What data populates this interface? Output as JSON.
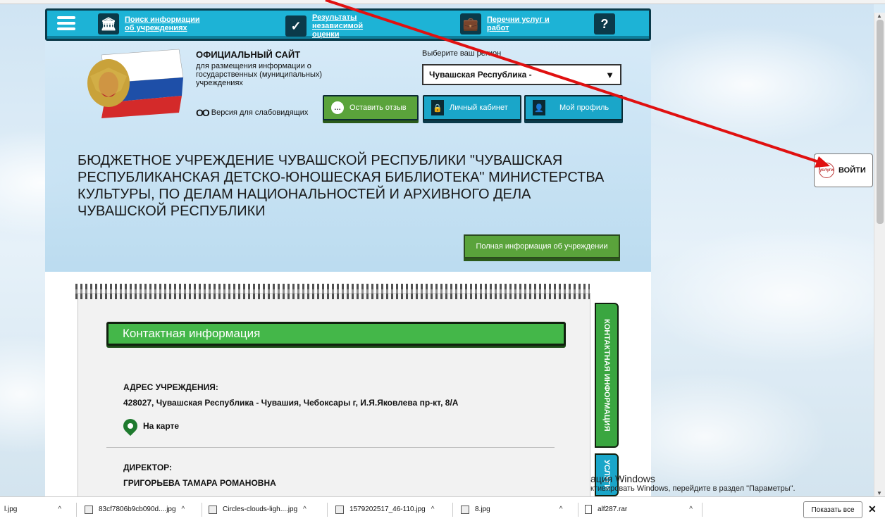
{
  "nav": {
    "item1": "Поиск информации об учреждениях",
    "item2": "Результаты независимой оценки",
    "item3": "Перечни услуг и работ"
  },
  "header": {
    "site_title": "ОФИЦИАЛЬНЫЙ САЙТ",
    "site_subtitle": "для размещения информации о государственных (муниципальных) учреждениях",
    "low_vision": "Версия для слабовидящих",
    "region_label": "Выберите ваш регион",
    "region_value": "Чувашская Республика -",
    "btn_feedback": "Оставить отзыв",
    "btn_cabinet": "Личный кабинет",
    "btn_profile": "Мой профиль"
  },
  "org": {
    "name": "БЮДЖЕТНОЕ УЧРЕЖДЕНИЕ ЧУВАШСКОЙ РЕСПУБЛИКИ \"ЧУВАШСКАЯ РЕСПУБЛИКАНСКАЯ ДЕТСКО-ЮНОШЕСКАЯ БИБЛИОТЕКА\" МИНИСТЕРСТВА КУЛЬТУРЫ, ПО ДЕЛАМ НАЦИОНАЛЬНОСТЕЙ И АРХИВНОГО ДЕЛА ЧУВАШСКОЙ РЕСПУБЛИКИ",
    "full_info_btn": "Полная информация об учреждении"
  },
  "contact": {
    "heading": "Контактная информация",
    "address_label": "АДРЕС УЧРЕЖДЕНИЯ:",
    "address_value": "428027, Чувашская Республика - Чувашия, Чебоксары г, И.Я.Яковлева пр-кт, 8/А",
    "map_link": "На карте",
    "director_label": "ДИРЕКТОР:",
    "director_value": "ГРИГОРЬЕВА ТАМАРА РОМАНОВНА"
  },
  "side_tabs": {
    "contact": "КОНТАКТНАЯ ИНФОРМАЦИЯ",
    "services": "УСЛУГИ"
  },
  "login": {
    "label": "ВОЙТИ",
    "icon_text": "услуги"
  },
  "activation": {
    "title": "ация Windows",
    "subtitle": "ктивировать Windows, перейдите в раздел \"Параметры\"."
  },
  "downloads": {
    "items": [
      "l.jpg",
      "83cf7806b9cb090d....jpg",
      "Circles-clouds-ligh....jpg",
      "1579202517_46-110.jpg",
      "8.jpg",
      "alf287.rar"
    ],
    "show_all": "Показать все"
  },
  "colors": {
    "nav_blue": "#1db3d6",
    "btn_green": "#5aa33b",
    "arrow_red": "#e01010"
  }
}
